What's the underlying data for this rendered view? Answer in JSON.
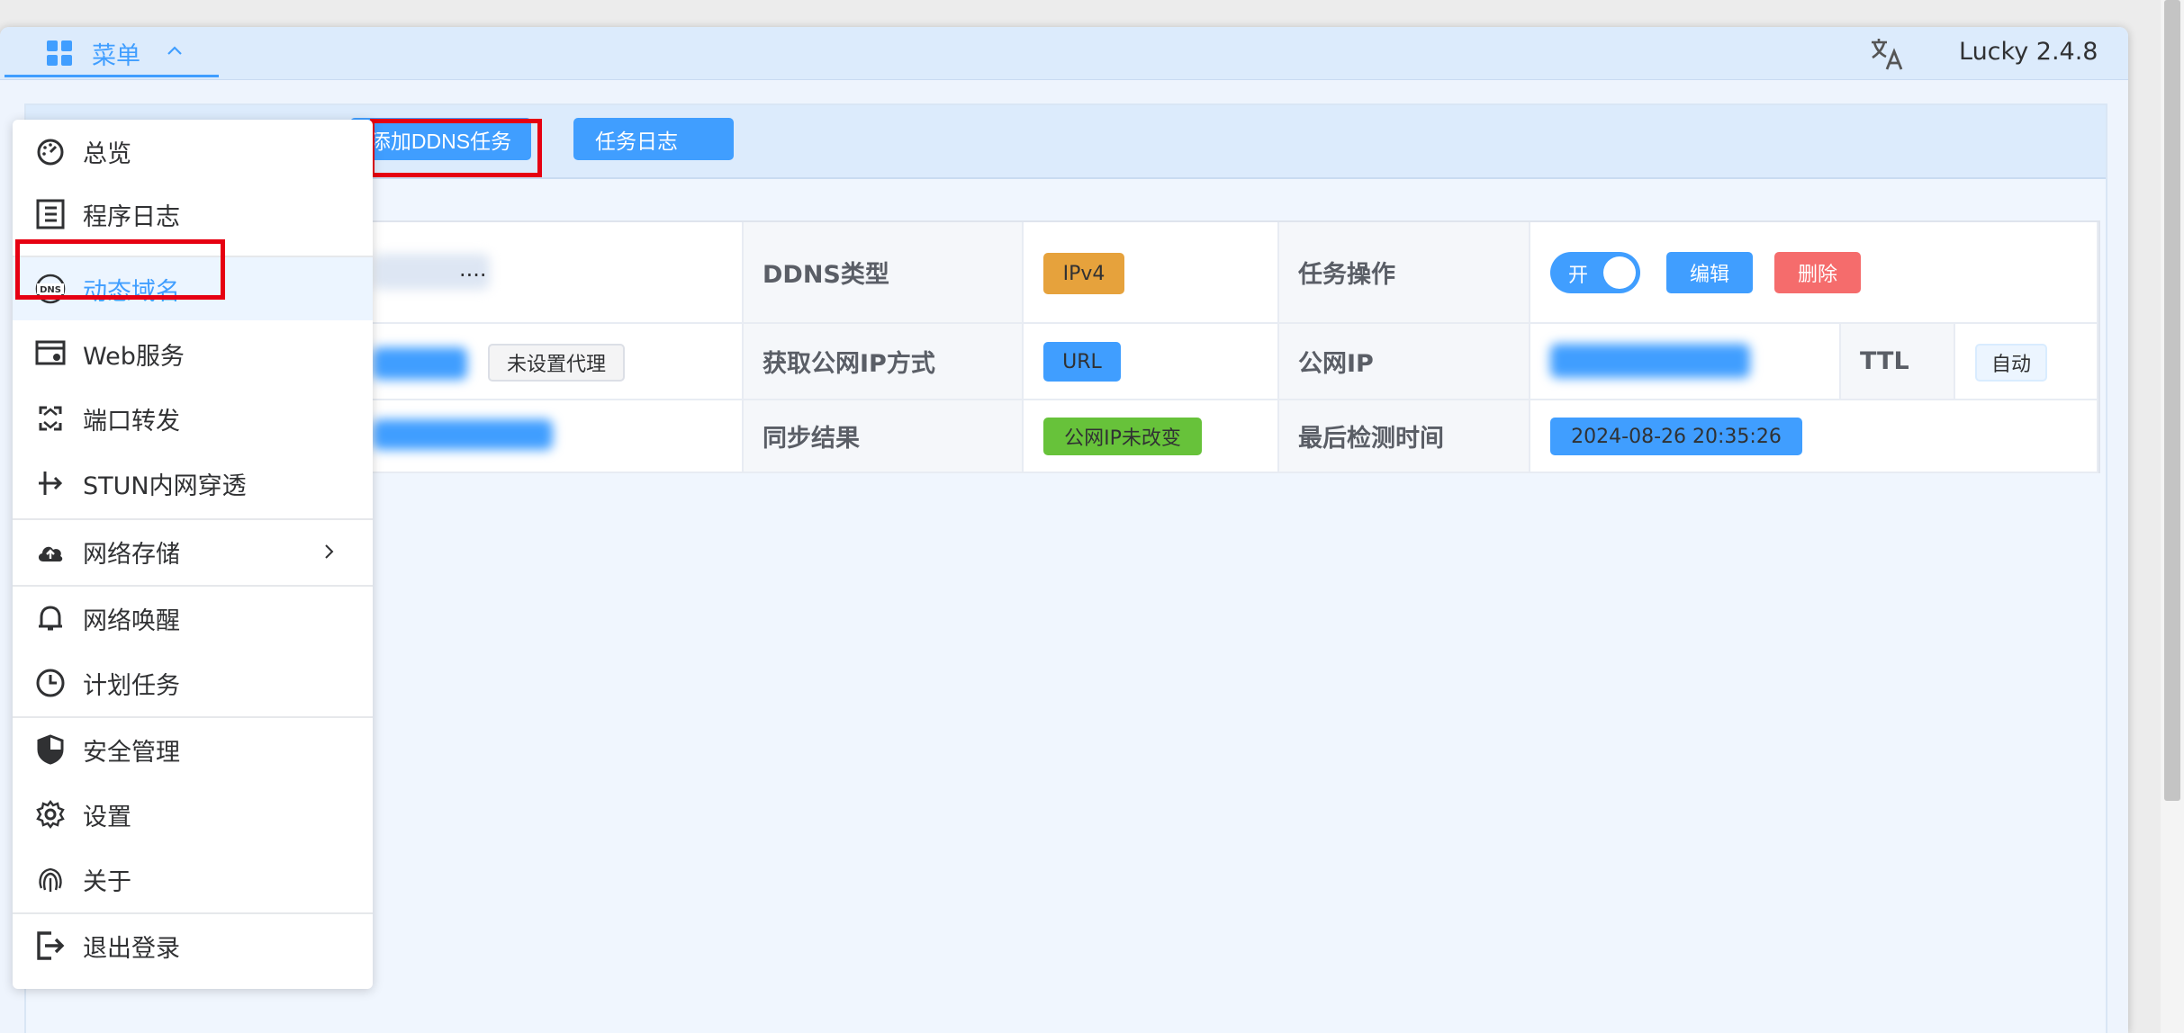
{
  "header": {
    "menu_label": "菜单",
    "version": "Lucky 2.4.8",
    "icons": {
      "menu": "grid-icon",
      "chevron": "chevron-up-icon",
      "language": "translate-icon"
    }
  },
  "toolbar": {
    "add_ddns_label": "添加DDNS任务",
    "task_log_label": "任务日志"
  },
  "menu": {
    "items": [
      {
        "label": "总览",
        "icon": "dashboard-icon"
      },
      {
        "label": "程序日志",
        "icon": "log-icon"
      },
      {
        "label": "动态域名",
        "icon": "dns-icon",
        "active": true
      },
      {
        "label": "Web服务",
        "icon": "web-service-icon"
      },
      {
        "label": "端口转发",
        "icon": "port-forward-icon"
      },
      {
        "label": "STUN内网穿透",
        "icon": "stun-icon"
      },
      {
        "label": "网络存储",
        "icon": "cloud-upload-icon",
        "submenu": true
      },
      {
        "label": "网络唤醒",
        "icon": "bell-icon"
      },
      {
        "label": "计划任务",
        "icon": "clock-icon"
      },
      {
        "label": "安全管理",
        "icon": "shield-icon"
      },
      {
        "label": "设置",
        "icon": "gear-icon"
      },
      {
        "label": "关于",
        "icon": "fingerprint-icon"
      },
      {
        "label": "退出登录",
        "icon": "logout-icon"
      }
    ]
  },
  "task": {
    "name_partial": "....",
    "row1": {
      "ddns_type_label": "DDNS类型",
      "ddns_type_value": "IPv4",
      "ops_label": "任务操作",
      "switch_label": "开",
      "edit_label": "编辑",
      "delete_label": "删除"
    },
    "row2": {
      "proxy_tag": "未设置代理",
      "ip_method_label": "获取公网IP方式",
      "ip_method_value": "URL",
      "public_ip_label": "公网IP",
      "ttl_label": "TTL",
      "ttl_value": "自动"
    },
    "row3": {
      "sync_label": "同步结果",
      "sync_value": "公网IP未改变",
      "last_check_label": "最后检测时间",
      "last_check_value": "2024-08-26 20:35:26"
    }
  },
  "colors": {
    "primary": "#409eff",
    "warning": "#e6a23c",
    "danger": "#f56c6c",
    "success": "#67c23a",
    "highlight": "#e60012"
  }
}
